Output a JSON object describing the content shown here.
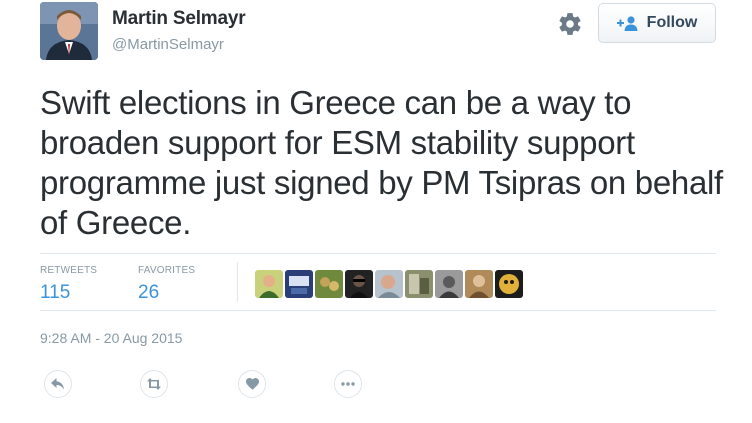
{
  "author": {
    "name": "Martin Selmayr",
    "handle": "@MartinSelmayr"
  },
  "follow_button": {
    "label": "Follow",
    "icon": "add-person-icon"
  },
  "settings": {
    "icon": "gear-icon"
  },
  "tweet": {
    "text": "Swift elections in Greece can be a way to broaden support for ESM stability support programme just signed by PM Tsipras on behalf of Greece."
  },
  "stats": {
    "retweets_label": "RETWEETS",
    "retweets_count": "115",
    "favorites_label": "FAVORITES",
    "favorites_count": "26"
  },
  "favoriters_count_shown": 9,
  "timestamp": "9:28 AM - 20 Aug 2015",
  "actions": [
    {
      "name": "reply",
      "icon": "reply-icon"
    },
    {
      "name": "retweet",
      "icon": "retweet-icon"
    },
    {
      "name": "favorite",
      "icon": "heart-icon"
    },
    {
      "name": "more",
      "icon": "more-icon"
    }
  ],
  "colors": {
    "text": "#292f33",
    "muted": "#8899a6",
    "link": "#3b94d9",
    "border": "#e1e8ed"
  }
}
